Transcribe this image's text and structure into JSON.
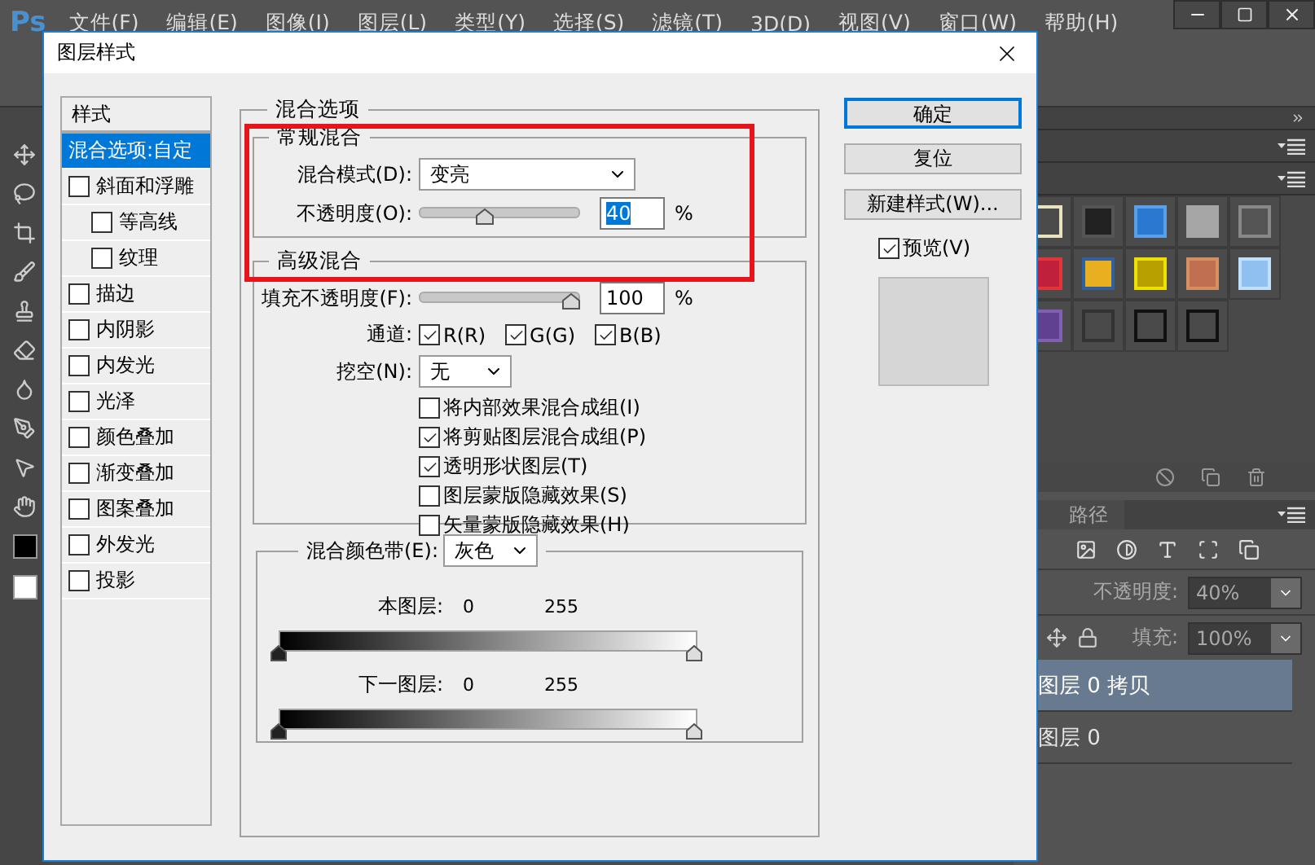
{
  "app": {
    "logo": "Ps",
    "menu": [
      "文件(F)",
      "编辑(E)",
      "图像(I)",
      "图层(L)",
      "类型(Y)",
      "选择(S)",
      "滤镜(T)",
      "3D(D)",
      "视图(V)",
      "窗口(W)",
      "帮助(H)"
    ]
  },
  "dialog": {
    "title": "图层样式",
    "styles_header": "样式",
    "styles": [
      {
        "kind": "options",
        "label": "混合选项:自定",
        "selected": true
      },
      {
        "kind": "effect",
        "label": "斜面和浮雕",
        "checked": false,
        "selected": false,
        "children": [
          {
            "kind": "effect",
            "label": "等高线",
            "checked": false,
            "selected": false
          },
          {
            "kind": "effect",
            "label": "纹理",
            "checked": false,
            "selected": false
          }
        ]
      },
      {
        "kind": "effect",
        "label": "描边",
        "checked": false,
        "selected": false
      },
      {
        "kind": "effect",
        "label": "内阴影",
        "checked": false,
        "selected": false
      },
      {
        "kind": "effect",
        "label": "内发光",
        "checked": false,
        "selected": false
      },
      {
        "kind": "effect",
        "label": "光泽",
        "checked": false,
        "selected": false
      },
      {
        "kind": "effect",
        "label": "颜色叠加",
        "checked": false,
        "selected": false
      },
      {
        "kind": "effect",
        "label": "渐变叠加",
        "checked": false,
        "selected": false
      },
      {
        "kind": "effect",
        "label": "图案叠加",
        "checked": false,
        "selected": false
      },
      {
        "kind": "effect",
        "label": "外发光",
        "checked": false,
        "selected": false
      },
      {
        "kind": "effect",
        "label": "投影",
        "checked": false,
        "selected": false
      }
    ],
    "blending": {
      "title": "混合选项",
      "general": {
        "title": "常规混合",
        "blend_mode": {
          "label": "混合模式(D):",
          "value": "变亮"
        },
        "opacity": {
          "label": "不透明度(O):",
          "level": 0.4,
          "value": "40",
          "value_selected": true,
          "unit": "%"
        }
      },
      "advanced": {
        "title": "高级混合",
        "fill_opacity": {
          "label": "填充不透明度(F):",
          "level": 1,
          "value": "100",
          "value_selected": false,
          "unit": "%"
        },
        "channels": {
          "label": "通道:",
          "items": [
            {
              "label": "R(R)",
              "checked": true
            },
            {
              "label": "G(G)",
              "checked": true
            },
            {
              "label": "B(B)",
              "checked": true
            }
          ]
        },
        "knockout": {
          "label": "挖空(N):",
          "value": "无"
        },
        "options": [
          {
            "label": "将内部效果混合成组(I)",
            "checked": false
          },
          {
            "label": "将剪贴图层混合成组(P)",
            "checked": true
          },
          {
            "label": "透明形状图层(T)",
            "checked": true
          },
          {
            "label": "图层蒙版隐藏效果(S)",
            "checked": false
          },
          {
            "label": "矢量蒙版隐藏效果(H)",
            "checked": false
          }
        ]
      },
      "blend_if": {
        "label": "混合颜色带(E):",
        "value": "灰色",
        "bands": [
          {
            "label": "本图层:",
            "low": "0",
            "high": "255"
          },
          {
            "label": "下一图层:",
            "low": "0",
            "high": "255"
          }
        ]
      }
    },
    "buttons": [
      {
        "label": "确定",
        "focused": true
      },
      {
        "label": "复位",
        "focused": false
      },
      {
        "label": "新建样式(W)...",
        "focused": false
      }
    ],
    "preview": {
      "label": "预览(V)",
      "checked": true
    }
  },
  "panels": {
    "paths_tab": "路径",
    "opacity": {
      "label": "不透明度:",
      "value": "40%"
    },
    "fill": {
      "label": "填充:",
      "value": "100%"
    },
    "layers": [
      {
        "name": "图层 0 拷贝",
        "selected": true
      },
      {
        "name": "图层 0",
        "selected": false
      }
    ]
  }
}
